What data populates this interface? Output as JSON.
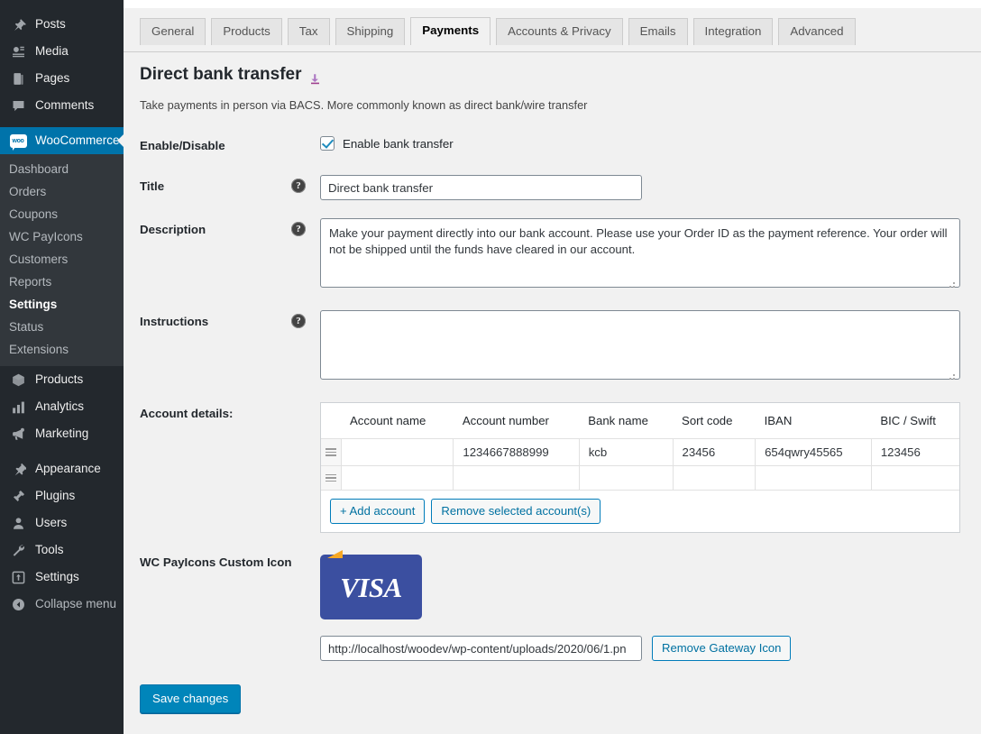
{
  "sidebar": {
    "top_items": [
      {
        "label": "Posts",
        "icon": "pin-icon"
      },
      {
        "label": "Media",
        "icon": "media-icon"
      },
      {
        "label": "Pages",
        "icon": "page-icon"
      },
      {
        "label": "Comments",
        "icon": "comment-icon"
      }
    ],
    "current": {
      "label": "WooCommerce",
      "icon": "woocommerce-icon"
    },
    "submenu": [
      {
        "label": "Dashboard",
        "active": false
      },
      {
        "label": "Orders",
        "active": false
      },
      {
        "label": "Coupons",
        "active": false
      },
      {
        "label": "WC PayIcons",
        "active": false
      },
      {
        "label": "Customers",
        "active": false
      },
      {
        "label": "Reports",
        "active": false
      },
      {
        "label": "Settings",
        "active": true
      },
      {
        "label": "Status",
        "active": false
      },
      {
        "label": "Extensions",
        "active": false
      }
    ],
    "mid_items": [
      {
        "label": "Products",
        "icon": "products-icon"
      },
      {
        "label": "Analytics",
        "icon": "analytics-icon"
      },
      {
        "label": "Marketing",
        "icon": "megaphone-icon"
      }
    ],
    "bottom_items": [
      {
        "label": "Appearance",
        "icon": "appearance-icon"
      },
      {
        "label": "Plugins",
        "icon": "plugins-icon"
      },
      {
        "label": "Users",
        "icon": "users-icon"
      },
      {
        "label": "Tools",
        "icon": "tools-icon"
      },
      {
        "label": "Settings",
        "icon": "settings-icon"
      },
      {
        "label": "Collapse menu",
        "icon": "collapse-icon"
      }
    ],
    "colors": {
      "background": "#23282d",
      "submenu_background": "#32373c",
      "active": "#0073aa"
    }
  },
  "tabs": [
    {
      "label": "General",
      "active": false
    },
    {
      "label": "Products",
      "active": false
    },
    {
      "label": "Tax",
      "active": false
    },
    {
      "label": "Shipping",
      "active": false
    },
    {
      "label": "Payments",
      "active": true
    },
    {
      "label": "Accounts & Privacy",
      "active": false
    },
    {
      "label": "Emails",
      "active": false
    },
    {
      "label": "Integration",
      "active": false
    },
    {
      "label": "Advanced",
      "active": false
    }
  ],
  "gateway": {
    "title": "Direct bank transfer",
    "back_icon": "return-arrow-icon",
    "description": "Take payments in person via BACS. More commonly known as direct bank/wire transfer"
  },
  "fields": {
    "enable": {
      "label": "Enable/Disable",
      "checkbox_label": "Enable bank transfer",
      "checked": true
    },
    "title": {
      "label": "Title",
      "value": "Direct bank transfer",
      "help": "?"
    },
    "description": {
      "label": "Description",
      "value": "Make your payment directly into our bank account. Please use your Order ID as the payment reference. Your order will not be shipped until the funds have cleared in our account.",
      "help": "?"
    },
    "instructions": {
      "label": "Instructions",
      "value": "",
      "help": "?"
    },
    "account_details": {
      "label": "Account details:",
      "columns": [
        "Account name",
        "Account number",
        "Bank name",
        "Sort code",
        "IBAN",
        "BIC / Swift"
      ],
      "rows": [
        [
          "",
          "1234667888999",
          "kcb",
          "23456",
          "654qwry45565",
          "123456"
        ],
        [
          "",
          "",
          "",
          "",
          "",
          ""
        ]
      ],
      "add_button": "+ Add account",
      "remove_button": "Remove selected account(s)"
    },
    "custom_icon": {
      "label": "WC PayIcons Custom Icon",
      "image_alt": "VISA",
      "visa_text": "VISA",
      "url": "http://localhost/woodev/wp-content/uploads/2020/06/1.pn",
      "remove_button": "Remove Gateway Icon",
      "colors": {
        "card_blue": "#3b4fa0",
        "swoosh": "#f7a823"
      }
    }
  },
  "submit": {
    "label": "Save changes",
    "color": "#0085ba"
  }
}
